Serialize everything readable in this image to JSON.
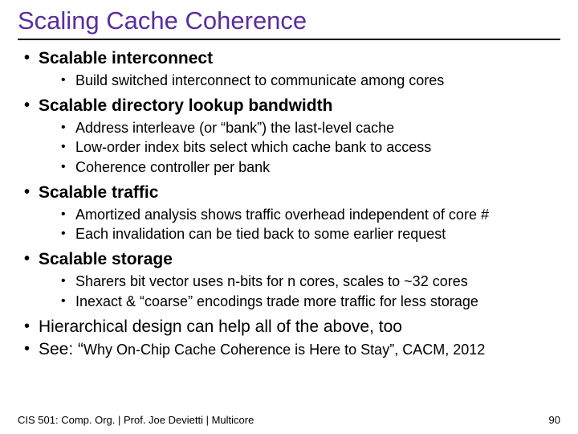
{
  "title": "Scaling Cache Coherence",
  "b1": {
    "heading": "Scalable interconnect",
    "p1": "Build switched interconnect to communicate among cores"
  },
  "b2": {
    "heading": "Scalable directory lookup bandwidth",
    "p1": "Address interleave (or “bank”) the last-level cache",
    "p2": "Low-order index bits select which cache bank to access",
    "p3": "Coherence controller per bank"
  },
  "b3": {
    "heading": "Scalable traffic",
    "p1": "Amortized analysis shows traffic overhead independent of core #",
    "p2": "Each invalidation can be tied back to some earlier request"
  },
  "b4": {
    "heading": "Scalable storage",
    "p1": "Sharers bit vector uses n-bits for n cores, scales to ~32 cores",
    "p2": "Inexact & “coarse” encodings trade more traffic for less storage"
  },
  "b5": "Hierarchical design can help all of the above, too",
  "b6": {
    "prefix": "See: “",
    "rest": "Why On-Chip Cache Coherence is Here to Stay”, CACM, 2012"
  },
  "footer": {
    "left": "CIS 501: Comp. Org. | Prof. Joe Devietti | Multicore",
    "right": "90"
  }
}
